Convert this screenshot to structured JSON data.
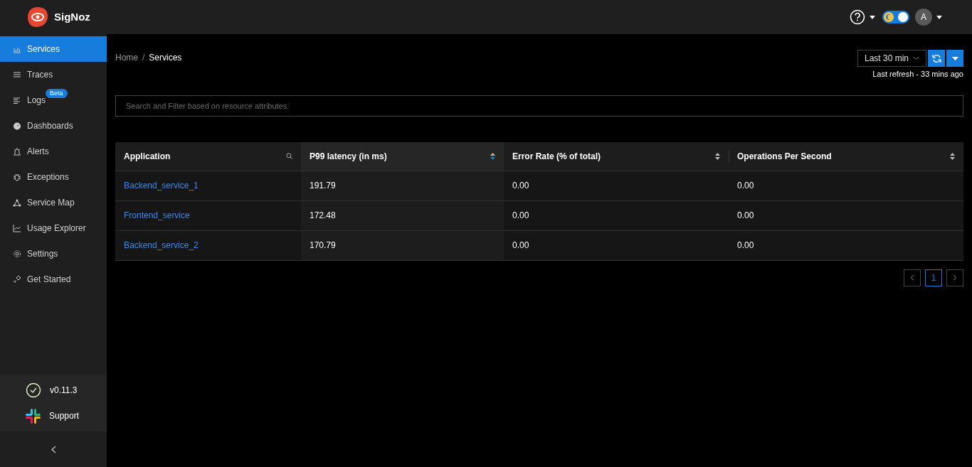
{
  "brand": "SigNoz",
  "header": {
    "theme_toggle": {
      "on": true
    },
    "avatar": "A"
  },
  "sidebar": {
    "items": [
      {
        "label": "Services",
        "selected": true
      },
      {
        "label": "Traces",
        "selected": false
      },
      {
        "label": "Logs",
        "selected": false,
        "badge": "Beta"
      },
      {
        "label": "Dashboards",
        "selected": false
      },
      {
        "label": "Alerts",
        "selected": false
      },
      {
        "label": "Exceptions",
        "selected": false
      },
      {
        "label": "Service Map",
        "selected": false
      },
      {
        "label": "Usage Explorer",
        "selected": false
      },
      {
        "label": "Settings",
        "selected": false
      },
      {
        "label": "Get Started",
        "selected": false
      }
    ],
    "footer": [
      {
        "kind": "version",
        "label": "v0.11.3"
      },
      {
        "kind": "support",
        "label": "Support"
      }
    ]
  },
  "breadcrumb": {
    "separator": "/",
    "items": [
      "Home",
      "Services"
    ]
  },
  "time_picker": {
    "value": "Last 30 min",
    "last_refresh": "Last refresh - 33 mins ago"
  },
  "search": {
    "placeholder": "Search and Filter based on resource attributes."
  },
  "table": {
    "columns": [
      {
        "label": "Application",
        "kind": "search"
      },
      {
        "label": "P99 latency (in ms)",
        "kind": "sort",
        "sorted": true
      },
      {
        "label": "Error Rate (% of total)",
        "kind": "sort",
        "sorted": false
      },
      {
        "label": "Operations Per Second",
        "kind": "sort",
        "sorted": false
      }
    ],
    "rows": [
      [
        "Backend_service_1",
        "191.79",
        "0.00",
        "0.00"
      ],
      [
        "Frontend_service",
        "172.48",
        "0.00",
        "0.00"
      ],
      [
        "Backend_service_2",
        "170.79",
        "0.00",
        "0.00"
      ]
    ]
  },
  "pagination": {
    "pages": [
      {
        "label": "1",
        "selected": true
      }
    ]
  }
}
